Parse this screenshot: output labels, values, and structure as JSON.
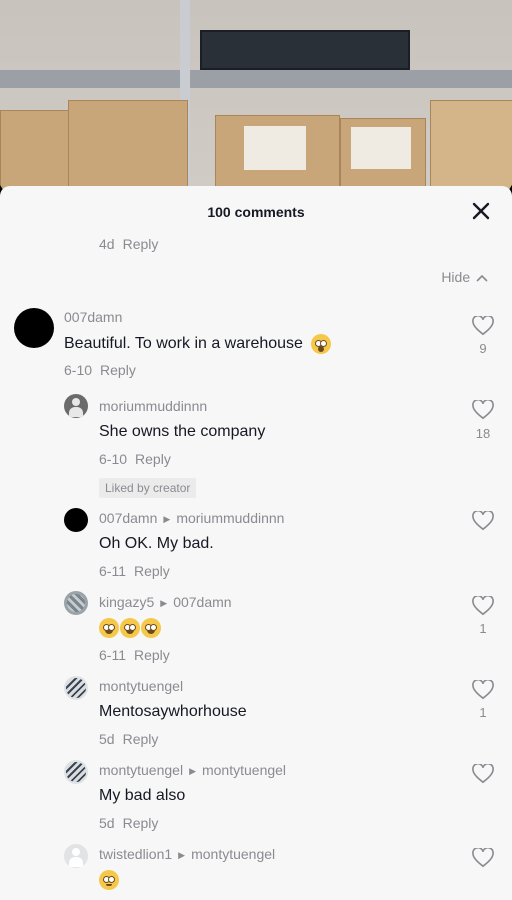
{
  "header": {
    "title": "100 comments"
  },
  "collapse": {
    "hide_label": "Hide"
  },
  "top_meta": {
    "time": "4d",
    "reply": "Reply"
  },
  "comments": [
    {
      "user": "007damn",
      "text": "Beautiful. To work in a warehouse",
      "time": "6-10",
      "reply": "Reply",
      "likes": "9"
    },
    {
      "user": "moriummuddinnn",
      "text": "She owns the company",
      "time": "6-10",
      "reply": "Reply",
      "likes": "18",
      "badge": "Liked by creator"
    },
    {
      "user": "007damn",
      "reply_to": "moriummuddinnn",
      "text": "Oh OK. My bad.",
      "time": "6-11",
      "reply": "Reply",
      "likes": ""
    },
    {
      "user": "kingazy5",
      "reply_to": "007damn",
      "text": "",
      "time": "6-11",
      "reply": "Reply",
      "likes": "1"
    },
    {
      "user": "montytuengel",
      "text": "Mentosaywhorhouse",
      "time": "5d",
      "reply": "Reply",
      "likes": "1"
    },
    {
      "user": "montytuengel",
      "reply_to": "montytuengel",
      "text": "My bad also",
      "time": "5d",
      "reply": "Reply",
      "likes": ""
    },
    {
      "user": "twistedlion1",
      "reply_to": "montytuengel",
      "text": "",
      "time": "",
      "reply": "",
      "likes": ""
    }
  ]
}
